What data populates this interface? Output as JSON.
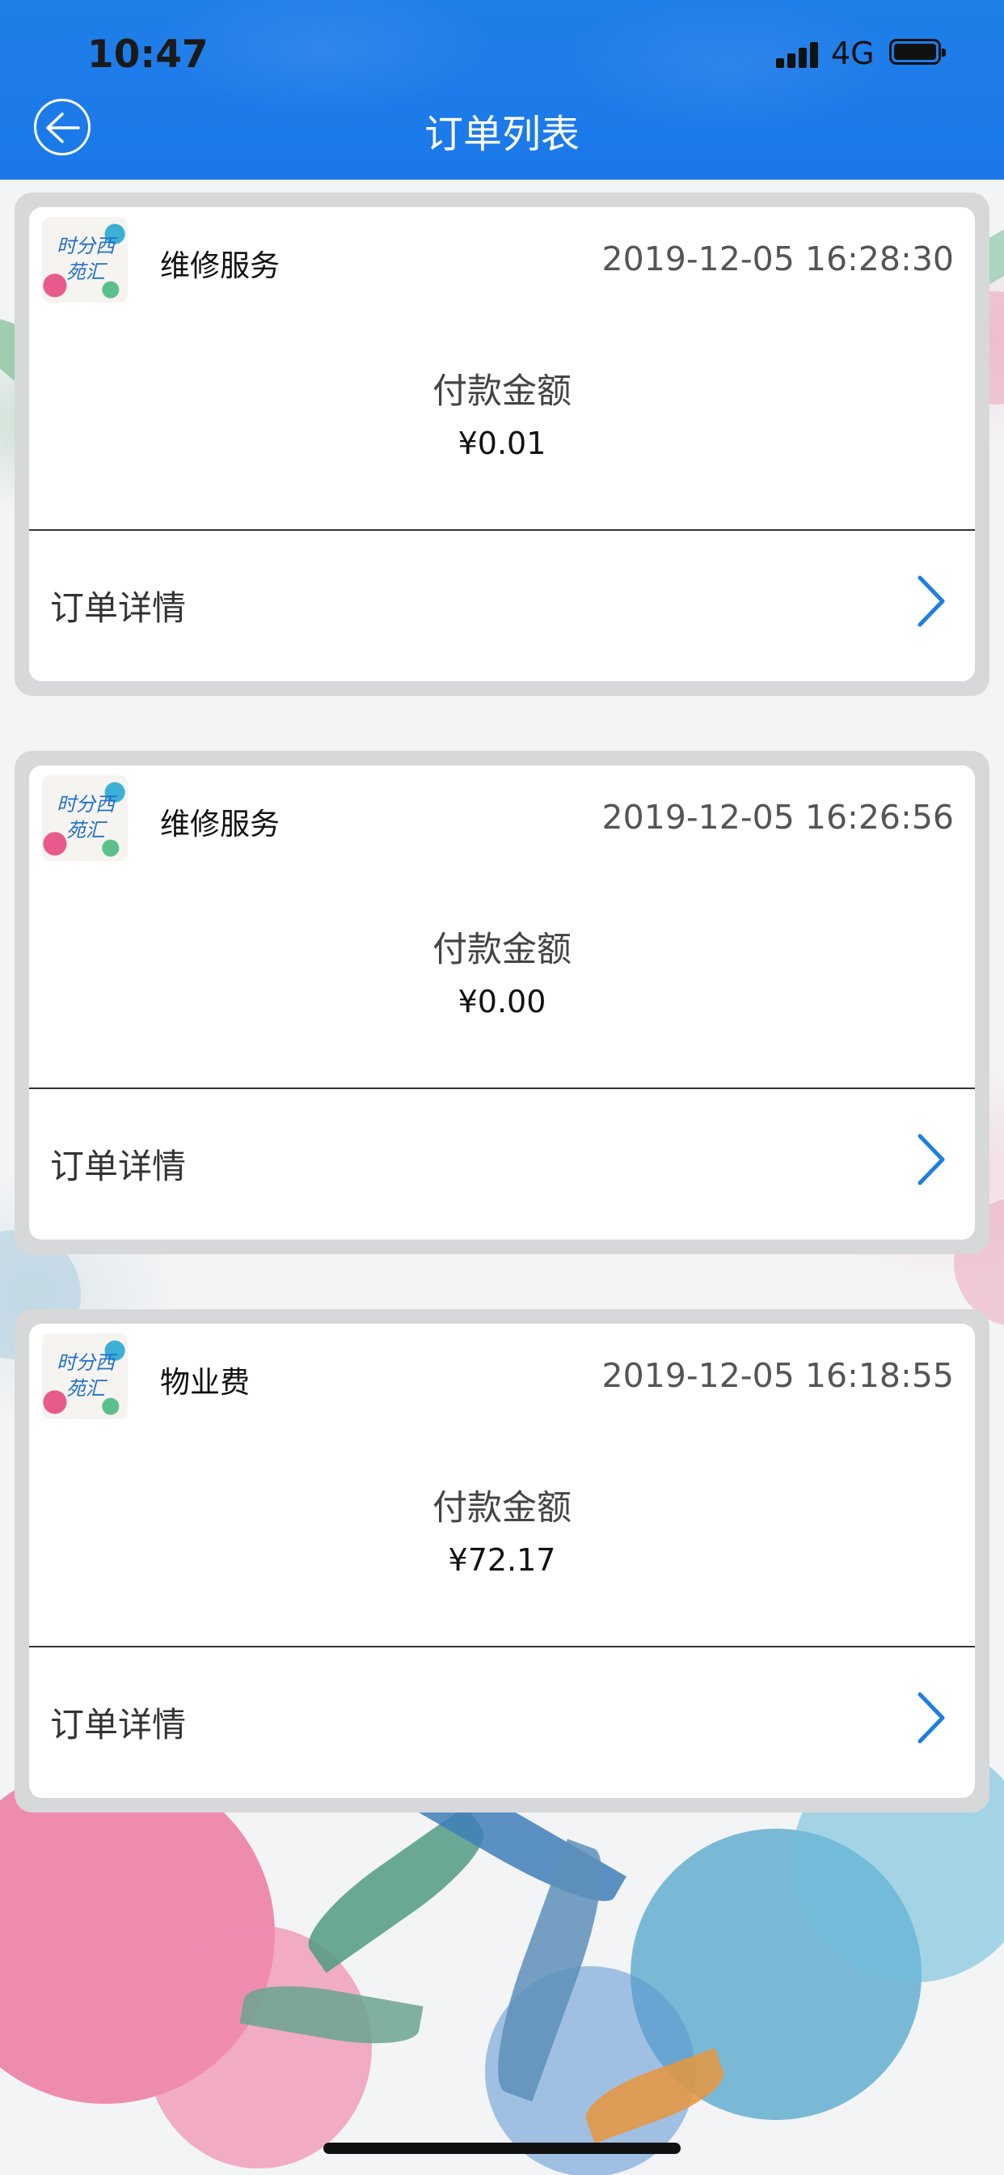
{
  "status_bar": {
    "time": "10:47",
    "network": "4G"
  },
  "nav": {
    "title": "订单列表",
    "back_icon": "back-arrow-circle-icon"
  },
  "orders": [
    {
      "service": "维修服务",
      "datetime": "2019-12-05 16:28:30",
      "amount_label": "付款金额",
      "amount": "¥0.01",
      "detail_label": "订单详情"
    },
    {
      "service": "维修服务",
      "datetime": "2019-12-05 16:26:56",
      "amount_label": "付款金额",
      "amount": "¥0.00",
      "detail_label": "订单详情"
    },
    {
      "service": "物业费",
      "datetime": "2019-12-05 16:18:55",
      "amount_label": "付款金额",
      "amount": "¥72.17",
      "detail_label": "订单详情"
    }
  ],
  "logo_text": "时分西苑汇",
  "colors": {
    "nav_blue": "#1a78ea",
    "chevron_blue": "#1f7fe0",
    "card_border": "#d7d8da"
  }
}
